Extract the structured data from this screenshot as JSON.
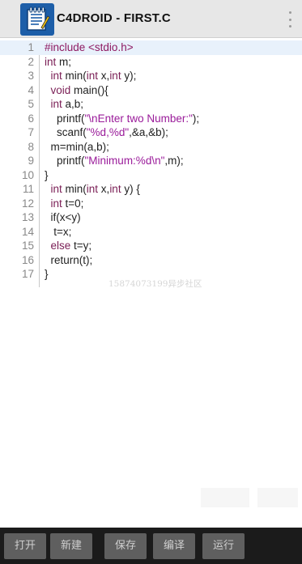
{
  "header": {
    "title": "C4DROID - FIRST.C",
    "logo_icon": "notepad-icon",
    "menu_icon": "more-vert-icon",
    "accent": "#1d5ea8"
  },
  "editor": {
    "lines": [
      {
        "n": "1",
        "segments": [
          {
            "t": "#include <stdio.h>",
            "c": "pp"
          }
        ]
      },
      {
        "n": "2",
        "segments": [
          {
            "t": "int",
            "c": "kw"
          },
          {
            "t": " m;",
            "c": ""
          }
        ]
      },
      {
        "n": "3",
        "segments": [
          {
            "t": "  ",
            "c": ""
          },
          {
            "t": "int",
            "c": "kw"
          },
          {
            "t": " min(",
            "c": ""
          },
          {
            "t": "int",
            "c": "kw"
          },
          {
            "t": " x,",
            "c": ""
          },
          {
            "t": "int",
            "c": "kw"
          },
          {
            "t": " y);",
            "c": ""
          }
        ]
      },
      {
        "n": "4",
        "segments": [
          {
            "t": "  ",
            "c": ""
          },
          {
            "t": "void",
            "c": "kw"
          },
          {
            "t": " main(){",
            "c": ""
          }
        ]
      },
      {
        "n": "5",
        "segments": [
          {
            "t": "  ",
            "c": ""
          },
          {
            "t": "int",
            "c": "kw"
          },
          {
            "t": " a,b;",
            "c": ""
          }
        ]
      },
      {
        "n": "6",
        "segments": [
          {
            "t": "    printf(",
            "c": ""
          },
          {
            "t": "\"\\nEnter two Number:\"",
            "c": "str"
          },
          {
            "t": ");",
            "c": ""
          }
        ]
      },
      {
        "n": "7",
        "segments": [
          {
            "t": "    scanf(",
            "c": ""
          },
          {
            "t": "\"%d,%d\"",
            "c": "str"
          },
          {
            "t": ",&a,&b);",
            "c": ""
          }
        ]
      },
      {
        "n": "8",
        "segments": [
          {
            "t": "  m=min(a,b);",
            "c": ""
          }
        ]
      },
      {
        "n": "9",
        "segments": [
          {
            "t": "    printf(",
            "c": ""
          },
          {
            "t": "\"Minimum:%d\\n\"",
            "c": "str"
          },
          {
            "t": ",m);",
            "c": ""
          }
        ]
      },
      {
        "n": "10",
        "segments": [
          {
            "t": "}",
            "c": ""
          }
        ]
      },
      {
        "n": "11",
        "segments": [
          {
            "t": "  ",
            "c": ""
          },
          {
            "t": "int",
            "c": "kw"
          },
          {
            "t": " min(",
            "c": ""
          },
          {
            "t": "int",
            "c": "kw"
          },
          {
            "t": " x,",
            "c": ""
          },
          {
            "t": "int",
            "c": "kw"
          },
          {
            "t": " y) {",
            "c": ""
          }
        ]
      },
      {
        "n": "12",
        "segments": [
          {
            "t": "  ",
            "c": ""
          },
          {
            "t": "int",
            "c": "kw"
          },
          {
            "t": " t=0;",
            "c": ""
          }
        ]
      },
      {
        "n": "13",
        "segments": [
          {
            "t": "  if(x<y)",
            "c": ""
          }
        ]
      },
      {
        "n": "14",
        "segments": [
          {
            "t": "   t=x;",
            "c": ""
          }
        ]
      },
      {
        "n": "15",
        "segments": [
          {
            "t": "  ",
            "c": ""
          },
          {
            "t": "else",
            "c": "kw"
          },
          {
            "t": " t=y;",
            "c": ""
          }
        ]
      },
      {
        "n": "16",
        "segments": [
          {
            "t": "  return(t);",
            "c": ""
          }
        ]
      },
      {
        "n": "17",
        "segments": [
          {
            "t": "}",
            "c": ""
          }
        ]
      }
    ],
    "active_line": "1"
  },
  "watermark": "15874073199异步社区",
  "toolbar": {
    "buttons": [
      {
        "label": "打开",
        "name": "open-button"
      },
      {
        "label": "新建",
        "name": "new-button"
      },
      {
        "label": "保存",
        "name": "save-button"
      },
      {
        "label": "编译",
        "name": "compile-button"
      },
      {
        "label": "运行",
        "name": "run-button"
      }
    ]
  }
}
